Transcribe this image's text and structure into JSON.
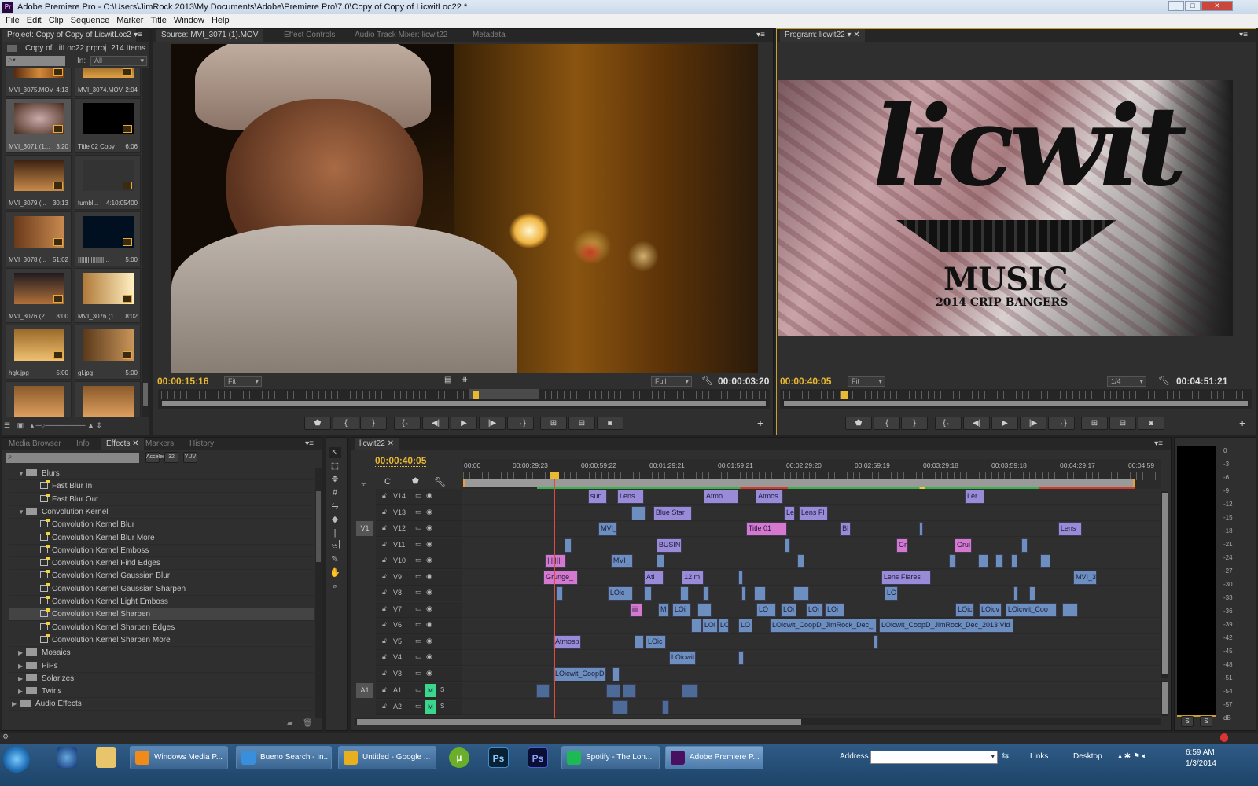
{
  "window": {
    "title": "Adobe Premiere Pro - C:\\Users\\JimRock 2013\\My Documents\\Adobe\\Premiere Pro\\7.0\\Copy of Copy of LicwitLoc22 *",
    "app_icon": "Pr"
  },
  "menu": [
    "File",
    "Edit",
    "Clip",
    "Sequence",
    "Marker",
    "Title",
    "Window",
    "Help"
  ],
  "project": {
    "tab": "Project: Copy of Copy of LicwitLoc2",
    "file": "Copy of...itLoc22.prproj",
    "count": "214 Items",
    "in_label": "In:",
    "in_value": "All",
    "items": [
      {
        "name": "MVI_3075.MOV",
        "dur": "4:13"
      },
      {
        "name": "MVI_3074.MOV",
        "dur": "2:04"
      },
      {
        "name": "MVI_3071 (1...",
        "dur": "3:20",
        "selected": true
      },
      {
        "name": "Title 02 Copy",
        "dur": "6:06"
      },
      {
        "name": "MVI_3079 (...",
        "dur": "30:13"
      },
      {
        "name": "tumbl...",
        "dur": "4:10:05400"
      },
      {
        "name": "MVI_3078 (...",
        "dur": "51:02"
      },
      {
        "name": "||||||||||||||||...",
        "dur": "5:00"
      },
      {
        "name": "MVI_3076 (2...",
        "dur": "3:00"
      },
      {
        "name": "MVI_3076 (1...",
        "dur": "8:02"
      },
      {
        "name": "hgk.jpg",
        "dur": "5:00"
      },
      {
        "name": "gl.jpg",
        "dur": "5:00"
      }
    ]
  },
  "source": {
    "tabs": [
      "Source: MVI_3071 (1).MOV",
      "Effect Controls",
      "Audio Track Mixer: licwit22",
      "Metadata"
    ],
    "timecode": "00:00:15:16",
    "fit": "Fit",
    "quality": "Full",
    "duration": "00:00:03:20"
  },
  "program": {
    "tab": "Program: licwit22",
    "timecode": "00:00:40:05",
    "fit": "Fit",
    "quality": "1/4",
    "duration": "00:04:51:21",
    "logo": {
      "script": "licwit",
      "word": "MUSIC",
      "sub": "2014 CRIP BANGERS"
    }
  },
  "controls": [
    "marker",
    "mark-in",
    "mark-out",
    "go-to-in",
    "step-back",
    "play",
    "step-forward",
    "go-to-out",
    "insert",
    "overwrite",
    "export-frame"
  ],
  "effects": {
    "tabs": [
      "Media Browser",
      "Info",
      "Effects",
      "Markers",
      "History"
    ],
    "rows": [
      {
        "label": "Blurs",
        "type": "folder",
        "open": true,
        "level": 1
      },
      {
        "label": "Fast Blur In",
        "type": "fx",
        "level": 2
      },
      {
        "label": "Fast Blur Out",
        "type": "fx",
        "level": 2
      },
      {
        "label": "Convolution Kernel",
        "type": "folder",
        "open": true,
        "level": 1
      },
      {
        "label": "Convolution Kernel Blur",
        "type": "fx",
        "level": 2
      },
      {
        "label": "Convolution Kernel Blur More",
        "type": "fx",
        "level": 2
      },
      {
        "label": "Convolution Kernel Emboss",
        "type": "fx",
        "level": 2
      },
      {
        "label": "Convolution Kernel Find Edges",
        "type": "fx",
        "level": 2
      },
      {
        "label": "Convolution Kernel Gaussian Blur",
        "type": "fx",
        "level": 2
      },
      {
        "label": "Convolution Kernel Gaussian Sharpen",
        "type": "fx",
        "level": 2
      },
      {
        "label": "Convolution Kernel Light Emboss",
        "type": "fx",
        "level": 2
      },
      {
        "label": "Convolution Kernel Sharpen",
        "type": "fx",
        "level": 2,
        "selected": true
      },
      {
        "label": "Convolution Kernel Sharpen Edges",
        "type": "fx",
        "level": 2
      },
      {
        "label": "Convolution Kernel Sharpen More",
        "type": "fx",
        "level": 2
      },
      {
        "label": "Mosaics",
        "type": "folder",
        "level": 1
      },
      {
        "label": "PiPs",
        "type": "folder",
        "level": 1
      },
      {
        "label": "Solarizes",
        "type": "folder",
        "level": 1
      },
      {
        "label": "Twirls",
        "type": "folder",
        "level": 1
      },
      {
        "label": "Audio Effects",
        "type": "folder",
        "level": 0
      }
    ],
    "filter_buttons": [
      "Accelerated",
      "32",
      "YUV"
    ]
  },
  "timeline": {
    "tab": "licwit22",
    "timecode": "00:00:40:05",
    "playhead_s": 40,
    "ruler": [
      "00:00",
      "00:00:29:23",
      "00:00:59:22",
      "00:01:29:21",
      "00:01:59:21",
      "00:02:29:20",
      "00:02:59:19",
      "00:03:29:18",
      "00:03:59:18",
      "00:04:29:17",
      "00:04:59"
    ],
    "tracks": [
      {
        "name": "V14",
        "kind": "video"
      },
      {
        "name": "V13",
        "kind": "video"
      },
      {
        "name": "V12",
        "kind": "video",
        "source": "V1"
      },
      {
        "name": "V11",
        "kind": "video"
      },
      {
        "name": "V10",
        "kind": "video"
      },
      {
        "name": "V9",
        "kind": "video"
      },
      {
        "name": "V8",
        "kind": "video"
      },
      {
        "name": "V7",
        "kind": "video"
      },
      {
        "name": "V6",
        "kind": "video"
      },
      {
        "name": "V5",
        "kind": "video"
      },
      {
        "name": "V4",
        "kind": "video"
      },
      {
        "name": "V3",
        "kind": "video"
      },
      {
        "name": "A1",
        "kind": "audio",
        "source": "A1",
        "mute": "M",
        "solo": "S"
      },
      {
        "name": "A2",
        "kind": "audio",
        "mute": "M",
        "solo": "S"
      }
    ],
    "clips": [
      {
        "t": 0,
        "s": 54.8,
        "e": 63.1,
        "c": "p",
        "l": "sun"
      },
      {
        "t": 0,
        "s": 67.6,
        "e": 79.3,
        "c": "p",
        "l": "Lens"
      },
      {
        "t": 0,
        "s": 105.5,
        "e": 120.7,
        "c": "p",
        "l": "Atmo"
      },
      {
        "t": 0,
        "s": 128.3,
        "e": 140.3,
        "c": "p",
        "l": "Atmos"
      },
      {
        "t": 0,
        "s": 220,
        "e": 228.6,
        "c": "p",
        "l": "Ler"
      },
      {
        "t": 1,
        "s": 73.8,
        "e": 80,
        "c": "v",
        "l": ""
      },
      {
        "t": 1,
        "s": 83.4,
        "e": 100.3,
        "c": "p",
        "l": "Blue Star"
      },
      {
        "t": 1,
        "s": 140.7,
        "e": 145.5,
        "c": "p",
        "l": "Le"
      },
      {
        "t": 1,
        "s": 147.2,
        "e": 160,
        "c": "p",
        "l": "Lens Fl"
      },
      {
        "t": 2,
        "s": 59.3,
        "e": 67.6,
        "c": "v",
        "l": "MVI_"
      },
      {
        "t": 2,
        "s": 124.1,
        "e": 142.1,
        "c": "k",
        "l": "Title 01"
      },
      {
        "t": 2,
        "s": 165.2,
        "e": 170,
        "c": "p",
        "l": "Bl"
      },
      {
        "t": 2,
        "s": 200,
        "e": 201.7,
        "c": "v",
        "l": ""
      },
      {
        "t": 2,
        "s": 261,
        "e": 271.4,
        "c": "p",
        "l": "Lens"
      },
      {
        "t": 3,
        "s": 44.5,
        "e": 47.6,
        "c": "v",
        "l": ""
      },
      {
        "t": 3,
        "s": 84.8,
        "e": 95.9,
        "c": "p",
        "l": "BUSINI"
      },
      {
        "t": 3,
        "s": 141,
        "e": 143.4,
        "c": "v",
        "l": ""
      },
      {
        "t": 3,
        "s": 190,
        "e": 195.2,
        "c": "k",
        "l": "Gr"
      },
      {
        "t": 3,
        "s": 215.5,
        "e": 223.1,
        "c": "k",
        "l": "Grui"
      },
      {
        "t": 3,
        "s": 244.8,
        "e": 247.6,
        "c": "v",
        "l": ""
      },
      {
        "t": 4,
        "s": 35.9,
        "e": 45.2,
        "c": "k",
        "l": "||||||||"
      },
      {
        "t": 4,
        "s": 64.8,
        "e": 74.5,
        "c": "v",
        "l": "MVI_"
      },
      {
        "t": 4,
        "s": 84.8,
        "e": 88.3,
        "c": "v",
        "l": ""
      },
      {
        "t": 4,
        "s": 146.6,
        "e": 149.7,
        "c": "v",
        "l": ""
      },
      {
        "t": 4,
        "s": 213.1,
        "e": 216.2,
        "c": "v",
        "l": ""
      },
      {
        "t": 4,
        "s": 225.9,
        "e": 230.3,
        "c": "v",
        "l": ""
      },
      {
        "t": 4,
        "s": 233.4,
        "e": 236.9,
        "c": "v",
        "l": ""
      },
      {
        "t": 4,
        "s": 240.3,
        "e": 243.1,
        "c": "v",
        "l": ""
      },
      {
        "t": 4,
        "s": 253.1,
        "e": 257.6,
        "c": "v",
        "l": ""
      },
      {
        "t": 5,
        "s": 35.2,
        "e": 50.3,
        "c": "k",
        "l": "Grunge_"
      },
      {
        "t": 5,
        "s": 79.3,
        "e": 87.9,
        "c": "p",
        "l": "Ati"
      },
      {
        "t": 5,
        "s": 95.9,
        "e": 105.5,
        "c": "p",
        "l": "12.m"
      },
      {
        "t": 5,
        "s": 120.7,
        "e": 122.8,
        "c": "v",
        "l": ""
      },
      {
        "t": 5,
        "s": 183.4,
        "e": 205.2,
        "c": "p",
        "l": "Lens Flares"
      },
      {
        "t": 5,
        "s": 267.6,
        "e": 277.9,
        "c": "v",
        "l": "MVI_3"
      },
      {
        "t": 6,
        "s": 40.7,
        "e": 43.8,
        "c": "v",
        "l": ""
      },
      {
        "t": 6,
        "s": 63.4,
        "e": 74.5,
        "c": "v",
        "l": "LOic"
      },
      {
        "t": 6,
        "s": 79.3,
        "e": 82.8,
        "c": "v",
        "l": ""
      },
      {
        "t": 6,
        "s": 95.2,
        "e": 99,
        "c": "v",
        "l": ""
      },
      {
        "t": 6,
        "s": 105.2,
        "e": 107.9,
        "c": "v",
        "l": ""
      },
      {
        "t": 6,
        "s": 122,
        "e": 124.1,
        "c": "v",
        "l": ""
      },
      {
        "t": 6,
        "s": 127.6,
        "e": 132.8,
        "c": "v",
        "l": ""
      },
      {
        "t": 6,
        "s": 144.8,
        "e": 151.7,
        "c": "v",
        "l": ""
      },
      {
        "t": 6,
        "s": 184.8,
        "e": 190.7,
        "c": "v",
        "l": "LC"
      },
      {
        "t": 6,
        "s": 241.4,
        "e": 243.4,
        "c": "v",
        "l": ""
      },
      {
        "t": 6,
        "s": 248.3,
        "e": 251,
        "c": "v",
        "l": ""
      },
      {
        "t": 7,
        "s": 73.1,
        "e": 78.6,
        "c": "k",
        "l": "iiii"
      },
      {
        "t": 7,
        "s": 85.5,
        "e": 90.3,
        "c": "v",
        "l": "M"
      },
      {
        "t": 7,
        "s": 91.7,
        "e": 100,
        "c": "v",
        "l": "LOi"
      },
      {
        "t": 7,
        "s": 102.8,
        "e": 109,
        "c": "v",
        "l": ""
      },
      {
        "t": 7,
        "s": 128.6,
        "e": 137.2,
        "c": "v",
        "l": "LO"
      },
      {
        "t": 7,
        "s": 139.3,
        "e": 146.2,
        "c": "v",
        "l": "LOi"
      },
      {
        "t": 7,
        "s": 150.3,
        "e": 157.9,
        "c": "v",
        "l": "LOi"
      },
      {
        "t": 7,
        "s": 158.6,
        "e": 167.2,
        "c": "v",
        "l": "LOi"
      },
      {
        "t": 7,
        "s": 215.9,
        "e": 224.1,
        "c": "v",
        "l": "LOic"
      },
      {
        "t": 7,
        "s": 226.2,
        "e": 236.2,
        "c": "v",
        "l": "LOicv"
      },
      {
        "t": 7,
        "s": 237.9,
        "e": 260.3,
        "c": "v",
        "l": "LOicwit_Coo"
      },
      {
        "t": 7,
        "s": 262.8,
        "e": 269.7,
        "c": "v",
        "l": ""
      },
      {
        "t": 8,
        "s": 100,
        "e": 104.8,
        "c": "v",
        "l": ""
      },
      {
        "t": 8,
        "s": 104.8,
        "e": 111.7,
        "c": "v",
        "l": "LOi"
      },
      {
        "t": 8,
        "s": 111.7,
        "e": 116.6,
        "c": "v",
        "l": "LC"
      },
      {
        "t": 8,
        "s": 120.7,
        "e": 126.9,
        "c": "v",
        "l": "LO"
      },
      {
        "t": 8,
        "s": 134.5,
        "e": 181.4,
        "c": "v",
        "l": "LOicwit_CoopD_JimRock_Dec_"
      },
      {
        "t": 8,
        "s": 182.4,
        "e": 241.4,
        "c": "v",
        "l": "LOicwit_CoopD_JimRock_Dec_2013 Vid"
      },
      {
        "t": 9,
        "s": 39.3,
        "e": 51.7,
        "c": "p",
        "l": "Atmosp"
      },
      {
        "t": 9,
        "s": 75.2,
        "e": 79.3,
        "c": "v",
        "l": ""
      },
      {
        "t": 9,
        "s": 80,
        "e": 89,
        "c": "v",
        "l": "LOic"
      },
      {
        "t": 9,
        "s": 180,
        "e": 182.1,
        "c": "v",
        "l": ""
      },
      {
        "t": 10,
        "s": 90.3,
        "e": 102.1,
        "c": "v",
        "l": "LOicwit"
      },
      {
        "t": 10,
        "s": 120.7,
        "e": 123.1,
        "c": "v",
        "l": ""
      },
      {
        "t": 11,
        "s": 39.3,
        "e": 62.8,
        "c": "v",
        "l": "LOicwit_CoopD"
      },
      {
        "t": 11,
        "s": 65.5,
        "e": 68.6,
        "c": "v",
        "l": ""
      },
      {
        "t": 12,
        "s": 32.1,
        "e": 37.9,
        "c": "a",
        "l": ""
      },
      {
        "t": 12,
        "s": 62.8,
        "e": 69,
        "c": "a",
        "l": ""
      },
      {
        "t": 12,
        "s": 70,
        "e": 75.9,
        "c": "a",
        "l": ""
      },
      {
        "t": 12,
        "s": 95.9,
        "e": 103.1,
        "c": "a",
        "l": ""
      },
      {
        "t": 13,
        "s": 65.5,
        "e": 72.4,
        "c": "a",
        "l": ""
      },
      {
        "t": 13,
        "s": 87.2,
        "e": 90.3,
        "c": "a",
        "l": ""
      }
    ]
  },
  "meter": {
    "scale": [
      "0",
      "-3",
      "-6",
      "-9",
      "-12",
      "-15",
      "-18",
      "-21",
      "-24",
      "-27",
      "-30",
      "-33",
      "-36",
      "-39",
      "-42",
      "-45",
      "-48",
      "-51",
      "-54",
      "-57",
      "dB"
    ],
    "solo": [
      "S",
      "S"
    ]
  },
  "taskbar": {
    "tasks": [
      "Windows Media P...",
      "Bueno Search - In...",
      "Untitled - Google ...",
      "Spotify - The Lon...",
      "Adobe Premiere P..."
    ],
    "address_label": "Address",
    "links": "Links",
    "desktop": "Desktop",
    "time": "6:59 AM",
    "date": "1/3/2014"
  },
  "colors": {
    "accent": "#e8b931",
    "clip_video": "#6d8fc0",
    "clip_purple": "#9a8bd8",
    "clip_pink": "#d678d0"
  }
}
